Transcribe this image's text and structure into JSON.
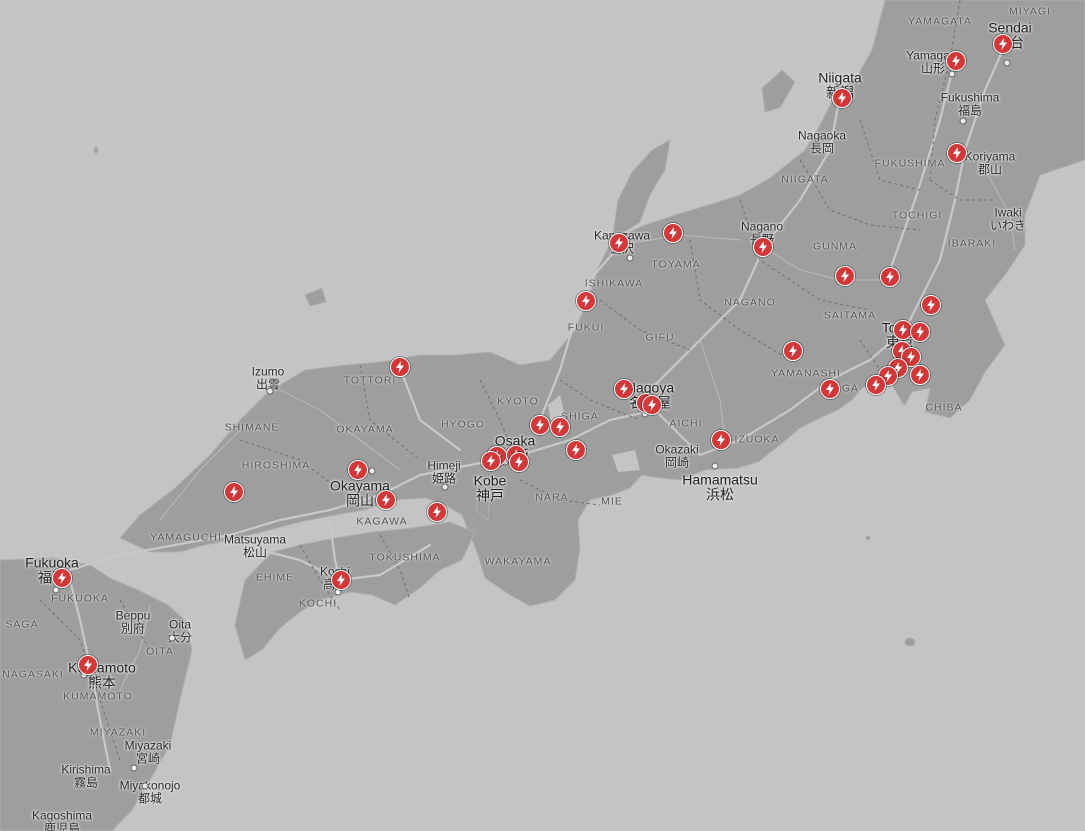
{
  "map": {
    "colors": {
      "sea": "#c4c4c4",
      "land": "#9e9e9e",
      "road": "#bdbdbd",
      "marker": "#d1383a",
      "marker_icon": "#ffffff"
    },
    "marker_icon": "lightning-bolt-icon",
    "cities": [
      {
        "id": "sendai",
        "en": "Sendai",
        "jp": "仙台"
      },
      {
        "id": "yamagata",
        "en": "Yamagata",
        "jp": "山形"
      },
      {
        "id": "niigata",
        "en": "Niigata",
        "jp": "新潟"
      },
      {
        "id": "nagaoka",
        "en": "Nagaoka",
        "jp": "長岡"
      },
      {
        "id": "fukushima",
        "en": "Fukushima",
        "jp": "福島"
      },
      {
        "id": "koriyama",
        "en": "Koriyama",
        "jp": "郡山"
      },
      {
        "id": "iwaki",
        "en": "Iwaki",
        "jp": "いわき"
      },
      {
        "id": "kanazawa",
        "en": "Kanazawa",
        "jp": "金沢"
      },
      {
        "id": "nagano",
        "en": "Nagano",
        "jp": "長野"
      },
      {
        "id": "tokyo",
        "en": "Tokyo",
        "jp": "東京"
      },
      {
        "id": "nagoya",
        "en": "Nagoya",
        "jp": "名古屋"
      },
      {
        "id": "okazaki",
        "en": "Okazaki",
        "jp": "岡崎"
      },
      {
        "id": "hamamatsu",
        "en": "Hamamatsu",
        "jp": "浜松"
      },
      {
        "id": "osaka",
        "en": "Osaka",
        "jp": "大阪"
      },
      {
        "id": "kobe",
        "en": "Kobe",
        "jp": "神戸"
      },
      {
        "id": "himeji",
        "en": "Himeji",
        "jp": "姫路"
      },
      {
        "id": "izumo",
        "en": "Izumo",
        "jp": "出雲"
      },
      {
        "id": "okayama",
        "en": "Okayama",
        "jp": "岡山"
      },
      {
        "id": "matsuyama",
        "en": "Matsuyama",
        "jp": "松山"
      },
      {
        "id": "kochi",
        "en": "Kochi",
        "jp": "高知"
      },
      {
        "id": "fukuoka",
        "en": "Fukuoka",
        "jp": "福岡"
      },
      {
        "id": "beppu",
        "en": "Beppu",
        "jp": "別府"
      },
      {
        "id": "oita",
        "en": "Oita",
        "jp": "大分"
      },
      {
        "id": "kumamoto",
        "en": "Kumamoto",
        "jp": "熊本"
      },
      {
        "id": "miyazaki",
        "en": "Miyazaki",
        "jp": "宮崎"
      },
      {
        "id": "kirishima",
        "en": "Kirishima",
        "jp": "霧島"
      },
      {
        "id": "miyakonojo",
        "en": "Miyakonojo",
        "jp": "都城"
      },
      {
        "id": "kagoshima",
        "en": "Kagoshima",
        "jp": "鹿児島"
      }
    ],
    "regions": [
      {
        "id": "yamagata",
        "text": "YAMAGATA"
      },
      {
        "id": "miyagi",
        "text": "MIYAGI"
      },
      {
        "id": "niigata",
        "text": "NIIGATA"
      },
      {
        "id": "fukushima",
        "text": "FUKUSHIMA"
      },
      {
        "id": "tochigi",
        "text": "TOCHIGI"
      },
      {
        "id": "gunma",
        "text": "GUNMA"
      },
      {
        "id": "ibaraki",
        "text": "IBARAKI"
      },
      {
        "id": "toyama",
        "text": "TOYAMA"
      },
      {
        "id": "ishikawa",
        "text": "ISHIKAWA"
      },
      {
        "id": "nagano",
        "text": "NAGANO"
      },
      {
        "id": "saitama",
        "text": "SAITAMA"
      },
      {
        "id": "fukui",
        "text": "FUKUI"
      },
      {
        "id": "gifu",
        "text": "GIFU"
      },
      {
        "id": "yamanashi",
        "text": "YAMANASHI"
      },
      {
        "id": "kanagawa",
        "text": "NAGA"
      },
      {
        "id": "chiba",
        "text": "CHIBA"
      },
      {
        "id": "tottori",
        "text": "TOTTORI"
      },
      {
        "id": "kyoto",
        "text": "KYOTO"
      },
      {
        "id": "shiga",
        "text": "SHIGA"
      },
      {
        "id": "aichi",
        "text": "AICHI"
      },
      {
        "id": "shizuoka",
        "text": "IZUOKA"
      },
      {
        "id": "shimane",
        "text": "SHIMANE"
      },
      {
        "id": "okayama",
        "text": "OKAYAMA"
      },
      {
        "id": "hyogo",
        "text": "HYOGO"
      },
      {
        "id": "hiroshima",
        "text": "HIROSHIMA"
      },
      {
        "id": "nara",
        "text": "NARA"
      },
      {
        "id": "mie",
        "text": "MIE"
      },
      {
        "id": "kagawa",
        "text": "KAGAWA"
      },
      {
        "id": "yamaguchi",
        "text": "YAMAGUCHI"
      },
      {
        "id": "tokushima",
        "text": "TOKUSHIMA"
      },
      {
        "id": "ehime",
        "text": "EHIME"
      },
      {
        "id": "kochi",
        "text": "KOCHI"
      },
      {
        "id": "wakayama",
        "text": "WAKAYAMA"
      },
      {
        "id": "fukuoka",
        "text": "FUKUOKA"
      },
      {
        "id": "saga",
        "text": "SAGA"
      },
      {
        "id": "oita",
        "text": "OITA"
      },
      {
        "id": "nagasaki",
        "text": "NAGASAKI"
      },
      {
        "id": "kumamoto",
        "text": "KUMAMOTO"
      },
      {
        "id": "miyazaki",
        "text": "MIYAZAKI"
      }
    ]
  }
}
